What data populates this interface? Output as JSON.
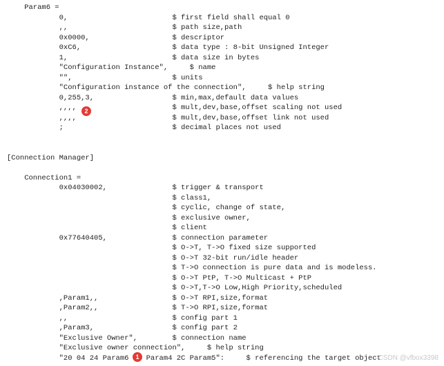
{
  "lines": [
    "    Param6 =",
    "            0,                        $ first field shall equal 0",
    "            ,,                        $ path size,path",
    "            0x0000,                   $ descriptor",
    "            0xC6,                     $ data type : 8-bit Unsigned Integer",
    "            1,                        $ data size in bytes",
    "            \"Configuration Instance\",     $ name",
    "            \"\",                       $ units",
    "            \"Configuration instance of the connection\",     $ help string",
    "            0,255,3,                  $ min,max,default data values",
    "            ,,,,                      $ mult,dev,base,offset scaling not used",
    "            ,,,,                      $ mult,dev,base,offset link not used",
    "            ;                         $ decimal places not used",
    "",
    "",
    "[Connection Manager]",
    "",
    "    Connection1 =",
    "            0x04030002,               $ trigger & transport",
    "                                      $ class1,",
    "                                      $ cyclic, change of state,",
    "                                      $ exclusive owner,",
    "                                      $ client",
    "            0x77640405,               $ connection parameter",
    "                                      $ O->T, T->O fixed size supported",
    "                                      $ O->T 32-bit run/idle header",
    "                                      $ T->O connection is pure data and is modeless.",
    "                                      $ O->T PtP, T->O Multicast + PtP",
    "                                      $ O->T,T->O Low,High Priority,scheduled",
    "            ,Param1,,                 $ O->T RPI,size,format",
    "            ,Param2,,                 $ T->O RPI,size,format",
    "            ,,                        $ config part 1",
    "            ,Param3,                  $ config part 2",
    "            \"Exclusive Owner\",        $ connection name",
    "            \"Exclusive owner connection\",     $ help string",
    "            \"20 04 24 Param6 2C Param4 2C Param5\":     $ referencing the target object"
  ],
  "badges": {
    "b1": "1",
    "b2": "2"
  },
  "watermark": "CSDN @vfbox3398"
}
